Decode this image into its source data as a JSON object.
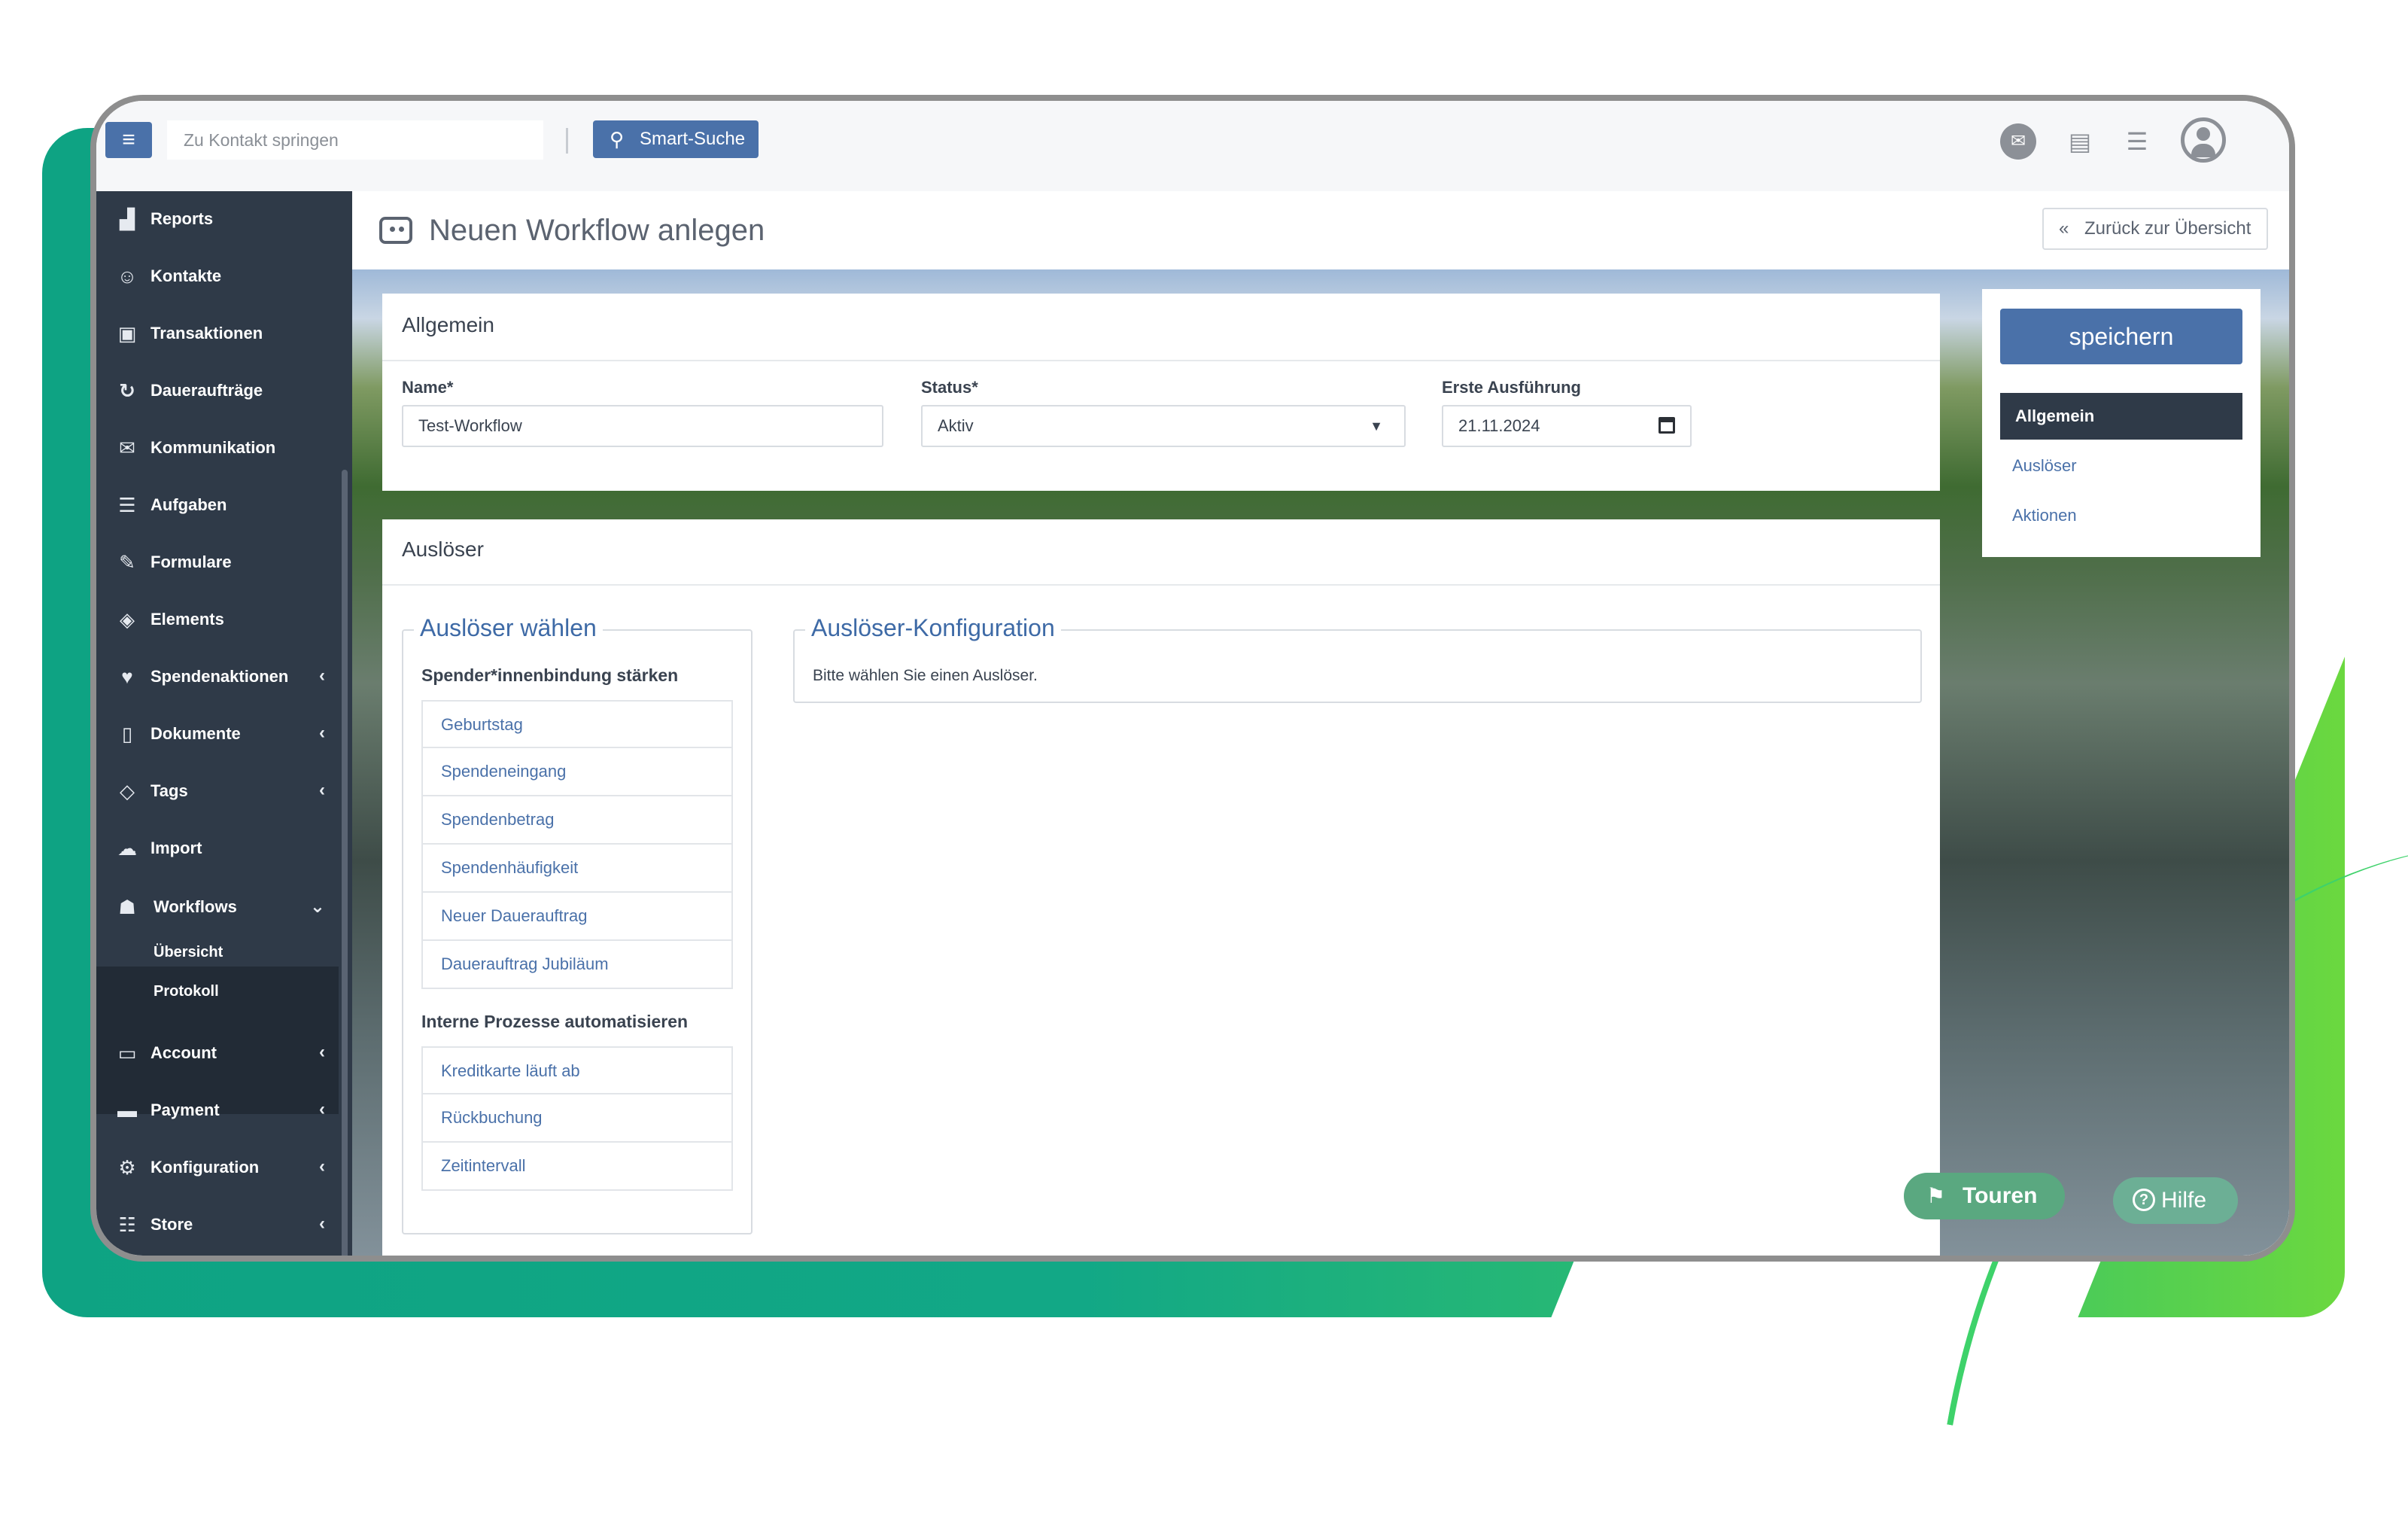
{
  "topbar": {
    "jump_placeholder": "Zu Kontakt springen",
    "smart_search_label": "Smart-Suche"
  },
  "sidebar": {
    "items": [
      {
        "label": "Reports",
        "icon": "chart-icon"
      },
      {
        "label": "Kontakte",
        "icon": "users-icon"
      },
      {
        "label": "Transaktionen",
        "icon": "money-icon"
      },
      {
        "label": "Daueraufträge",
        "icon": "recurring-icon"
      },
      {
        "label": "Kommunikation",
        "icon": "chat-icon"
      },
      {
        "label": "Aufgaben",
        "icon": "tasks-icon"
      },
      {
        "label": "Formulare",
        "icon": "edit-icon"
      },
      {
        "label": "Elements",
        "icon": "puzzle-icon"
      },
      {
        "label": "Spendenaktionen",
        "icon": "thumbs-up-icon"
      },
      {
        "label": "Dokumente",
        "icon": "document-icon"
      },
      {
        "label": "Tags",
        "icon": "tags-icon"
      },
      {
        "label": "Import",
        "icon": "cloud-upload-icon"
      },
      {
        "label": "Workflows",
        "icon": "robot-icon"
      },
      {
        "label": "Account",
        "icon": "briefcase-icon"
      },
      {
        "label": "Payment",
        "icon": "card-icon"
      },
      {
        "label": "Konfiguration",
        "icon": "gear-icon"
      },
      {
        "label": "Store",
        "icon": "store-icon"
      }
    ],
    "sub_items": [
      "Übersicht",
      "Protokoll"
    ]
  },
  "page": {
    "title": "Neuen Workflow anlegen",
    "back_label": "Zurück zur Übersicht"
  },
  "general": {
    "heading": "Allgemein",
    "name_label": "Name*",
    "name_value": "Test-Workflow",
    "status_label": "Status*",
    "status_value": "Aktiv",
    "first_run_label": "Erste Ausführung",
    "first_run_value": "21.11.2024"
  },
  "trigger": {
    "heading": "Auslöser",
    "choose_legend": "Auslöser wählen",
    "group1_title": "Spender*innenbindung stärken",
    "group1_options": [
      "Geburtstag",
      "Spendeneingang",
      "Spendenbetrag",
      "Spendenhäufigkeit",
      "Neuer Dauerauftrag",
      "Dauerauftrag Jubiläum"
    ],
    "group2_title": "Interne Prozesse automatisieren",
    "group2_options": [
      "Kreditkarte läuft ab",
      "Rückbuchung",
      "Zeitintervall"
    ],
    "config_legend": "Auslöser-Konfiguration",
    "config_hint": "Bitte wählen Sie einen Auslöser."
  },
  "side": {
    "save_label": "speichern",
    "nav": [
      "Allgemein",
      "Auslöser",
      "Aktionen"
    ]
  },
  "floating": {
    "touren_label": "Touren",
    "hilfe_label": "Hilfe"
  },
  "colors": {
    "primary": "#4a71a9",
    "sidebar": "#2f3a48",
    "backdrop_green": "#12a886",
    "floating_green": "#5aa880"
  }
}
